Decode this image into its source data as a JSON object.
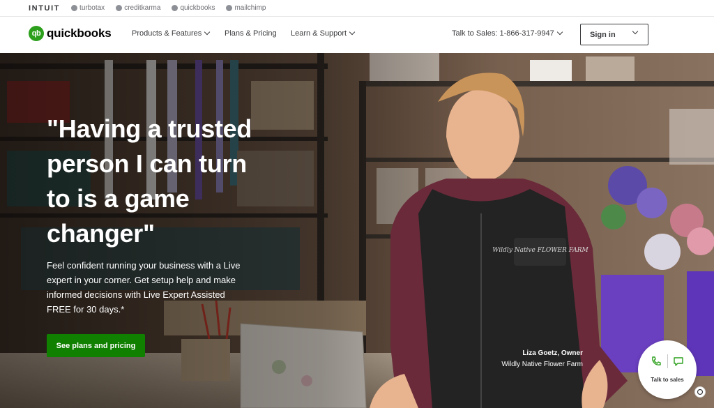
{
  "brandbar": {
    "intuit": "INTUIT",
    "items": [
      {
        "label": "turbotax",
        "icon": "turbotax-icon"
      },
      {
        "label": "creditkarma",
        "icon": "creditkarma-icon"
      },
      {
        "label": "quickbooks",
        "icon": "quickbooks-icon"
      },
      {
        "label": "mailchimp",
        "icon": "mailchimp-icon"
      }
    ]
  },
  "nav": {
    "logo_mark": "qb",
    "logo_text": "quickbooks",
    "products": "Products & Features",
    "plans": "Plans & Pricing",
    "learn": "Learn & Support",
    "sales": "Talk to Sales: 1-866-317-9947",
    "signin": "Sign in"
  },
  "hero": {
    "title": "\"Having a trusted person I can turn to is a game changer\"",
    "subtitle": "Feel confident running your business with a Live expert in your corner. Get setup help and make informed decisions with Live Expert Assisted FREE for 30 days.*",
    "cta": "See plans and pricing",
    "caption_name": "Liza Goetz, Owner",
    "caption_company": "Wildly Native Flower Farm",
    "vest_logo": "Wildly Native FLOWER FARM"
  },
  "chat": {
    "label": "Talk to sales"
  },
  "colors": {
    "brand_green": "#2ca01c",
    "cta_green": "#108000",
    "text_dark": "#393a3d"
  }
}
